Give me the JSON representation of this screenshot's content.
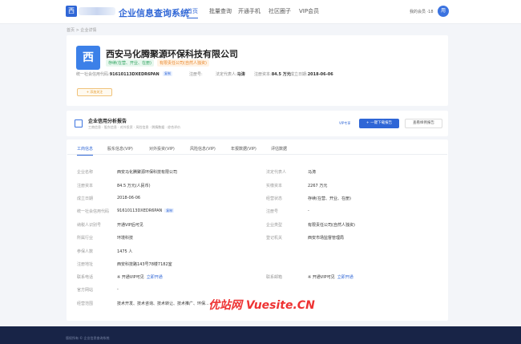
{
  "header": {
    "logo_char": "西",
    "brand": "企业信息查询系统",
    "nav": [
      "首页",
      "批量查询",
      "开通手机",
      "社区圈子",
      "VIP会员"
    ],
    "user": "我的会员 ·18",
    "avatar": "用"
  },
  "breadcrumb": "首页 > 企业详情",
  "company": {
    "icon": "西",
    "name": "西安马化腾聚源环保科技有限公司",
    "tags": [
      "存续(在营、开业、在册)",
      "有限责任公司(自然人独资)"
    ],
    "credit_label": "统一社会信用代码:",
    "credit_code": "91610113DXEDR6PAN",
    "copy": "复制",
    "reg_no_label": "注册号:",
    "rep_label": "法定代表人:",
    "rep": "马涛",
    "capital_label": "注册资本:",
    "capital": "84.5 万元",
    "founded_label": "成立日期:",
    "founded": "2018-06-06",
    "follow": "+ 添加关注"
  },
  "report": {
    "title": "企业信用分析报告",
    "subtitle": "工商信息 · 股东信息 · 对外投资 · 风险信息 · 舆情数据 · 综合评价",
    "vip_share": "VIP专享",
    "primary_btn": "+ 一键下载报告",
    "ghost_btn": "查看样例报告"
  },
  "tabs": [
    "工商信息",
    "股东信息(VIP)",
    "对外投资(VIP)",
    "风险信息(VIP)",
    "年报数据(VIP)",
    "评估数据"
  ],
  "info": [
    {
      "l": "企业名称",
      "v": "西安马化腾聚源环保科技有限公司"
    },
    {
      "l": "法定代表人",
      "v": "马涛"
    },
    {
      "l": "注册资本",
      "v": "84.5 万元(人民币)"
    },
    {
      "l": "实缴资本",
      "v": "2267 万元"
    },
    {
      "l": "成立日期",
      "v": "2018-06-06"
    },
    {
      "l": "经营状态",
      "v": "存续(在营、开业、在册)"
    },
    {
      "l": "统一社会信用代码",
      "v": "91610113DXEDR6PAN",
      "copy": "复制"
    },
    {
      "l": "注册号",
      "v": "-"
    },
    {
      "l": "纳税人识别号",
      "v": "开通VIP后可见"
    },
    {
      "l": "企业类型",
      "v": "有限责任公司(自然人独资)"
    },
    {
      "l": "所属行业",
      "v": "环境科技"
    },
    {
      "l": "登记机关",
      "v": "西安市场监督管理局"
    },
    {
      "l": "参保人数",
      "v": "1475 人"
    },
    {
      "l": "注册地址",
      "v": "西安科技路143号78楼7182室"
    },
    {
      "l": "联系电话",
      "v": "※ 开通VIP可见",
      "link": "立即开通"
    },
    {
      "l": "联系邮箱",
      "v": "※ 开通VIP可见",
      "link": "立即开通"
    },
    {
      "l": "官方网站",
      "v": "-"
    },
    {
      "l": "经营范围",
      "v": "技术开发、技术咨询、技术转让、技术推广、环保..."
    }
  ],
  "watermark": "优站网 Vuesite.CN",
  "footer": "版权所有 © 企业信息查询系统"
}
